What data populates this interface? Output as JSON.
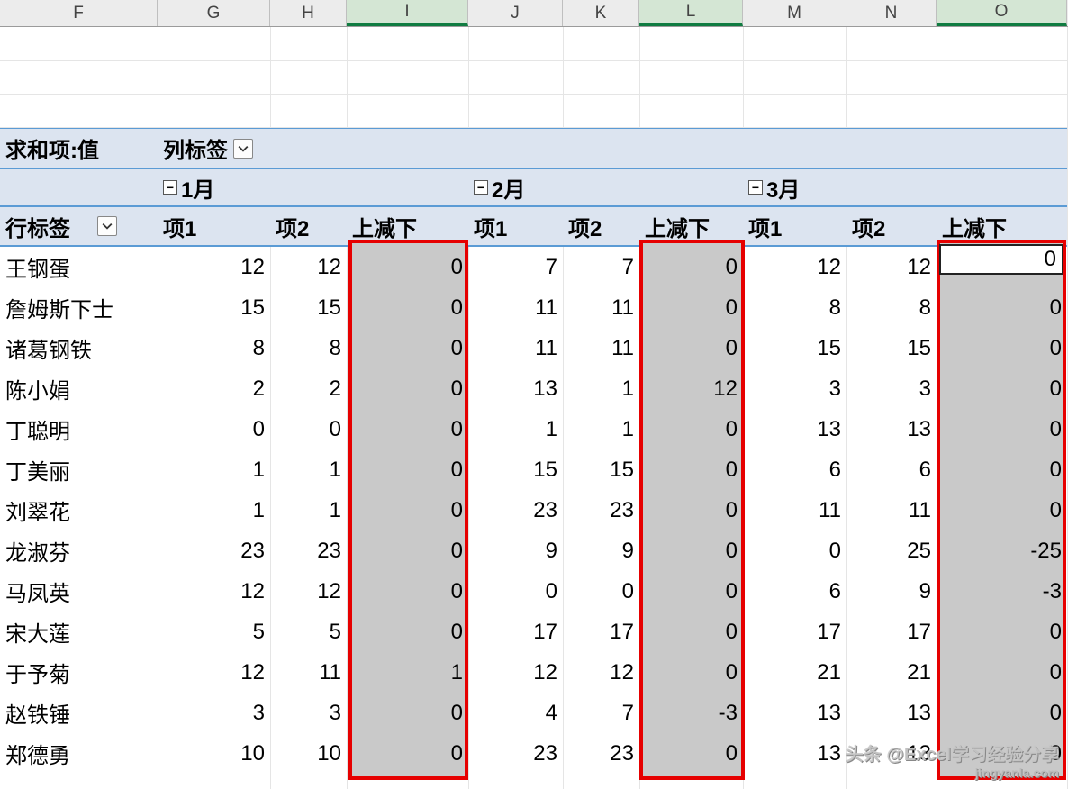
{
  "columns": [
    "F",
    "G",
    "H",
    "I",
    "J",
    "K",
    "L",
    "M",
    "N",
    "O"
  ],
  "selected_columns": [
    "I",
    "L",
    "O"
  ],
  "pivot": {
    "value_field_label": "求和项:值",
    "col_labels_label": "列标签",
    "row_labels_label": "行标签",
    "months": [
      "1月",
      "2月",
      "3月"
    ],
    "sub_labels": [
      "项1",
      "项2",
      "上减下"
    ],
    "collapse_symbol": "−"
  },
  "active_cell_value": "0",
  "rows": [
    {
      "name": "王钢蛋",
      "v": [
        12,
        12,
        0,
        7,
        7,
        0,
        12,
        12,
        0
      ]
    },
    {
      "name": "詹姆斯下士",
      "v": [
        15,
        15,
        0,
        11,
        11,
        0,
        8,
        8,
        0
      ]
    },
    {
      "name": "诸葛钢铁",
      "v": [
        8,
        8,
        0,
        11,
        11,
        0,
        15,
        15,
        0
      ]
    },
    {
      "name": "陈小娟",
      "v": [
        2,
        2,
        0,
        13,
        1,
        12,
        3,
        3,
        0
      ]
    },
    {
      "name": "丁聪明",
      "v": [
        0,
        0,
        0,
        1,
        1,
        0,
        13,
        13,
        0
      ]
    },
    {
      "name": "丁美丽",
      "v": [
        1,
        1,
        0,
        15,
        15,
        0,
        6,
        6,
        0
      ]
    },
    {
      "name": "刘翠花",
      "v": [
        1,
        1,
        0,
        23,
        23,
        0,
        11,
        11,
        0
      ]
    },
    {
      "name": "龙淑芬",
      "v": [
        23,
        23,
        0,
        9,
        9,
        0,
        0,
        25,
        -25
      ]
    },
    {
      "name": "马凤英",
      "v": [
        12,
        12,
        0,
        0,
        0,
        0,
        6,
        9,
        -3
      ]
    },
    {
      "name": "宋大莲",
      "v": [
        5,
        5,
        0,
        17,
        17,
        0,
        17,
        17,
        0
      ]
    },
    {
      "name": "于予菊",
      "v": [
        12,
        11,
        1,
        12,
        12,
        0,
        21,
        21,
        0
      ]
    },
    {
      "name": "赵铁锤",
      "v": [
        3,
        3,
        0,
        4,
        7,
        -3,
        13,
        13,
        0
      ]
    },
    {
      "name": "郑德勇",
      "v": [
        10,
        10,
        0,
        23,
        23,
        0,
        13,
        13,
        0
      ]
    }
  ],
  "watermark": {
    "line1": "头条 @Excel学习经验分享",
    "line2": "jingyanla.com"
  },
  "chart_data": {
    "type": "table",
    "title": "求和项:值",
    "row_field": "行标签",
    "column_field": "列标签",
    "column_groups": [
      "1月",
      "2月",
      "3月"
    ],
    "sub_columns": [
      "项1",
      "项2",
      "上减下"
    ],
    "rows": [
      {
        "label": "王钢蛋",
        "1月": {
          "项1": 12,
          "项2": 12,
          "上减下": 0
        },
        "2月": {
          "项1": 7,
          "项2": 7,
          "上减下": 0
        },
        "3月": {
          "项1": 12,
          "项2": 12,
          "上减下": 0
        }
      },
      {
        "label": "詹姆斯下士",
        "1月": {
          "项1": 15,
          "项2": 15,
          "上减下": 0
        },
        "2月": {
          "项1": 11,
          "项2": 11,
          "上减下": 0
        },
        "3月": {
          "项1": 8,
          "项2": 8,
          "上减下": 0
        }
      },
      {
        "label": "诸葛钢铁",
        "1月": {
          "项1": 8,
          "项2": 8,
          "上减下": 0
        },
        "2月": {
          "项1": 11,
          "项2": 11,
          "上减下": 0
        },
        "3月": {
          "项1": 15,
          "项2": 15,
          "上减下": 0
        }
      },
      {
        "label": "陈小娟",
        "1月": {
          "项1": 2,
          "项2": 2,
          "上减下": 0
        },
        "2月": {
          "项1": 13,
          "项2": 1,
          "上减下": 12
        },
        "3月": {
          "项1": 3,
          "项2": 3,
          "上减下": 0
        }
      },
      {
        "label": "丁聪明",
        "1月": {
          "项1": 0,
          "项2": 0,
          "上减下": 0
        },
        "2月": {
          "项1": 1,
          "项2": 1,
          "上减下": 0
        },
        "3月": {
          "项1": 13,
          "项2": 13,
          "上减下": 0
        }
      },
      {
        "label": "丁美丽",
        "1月": {
          "项1": 1,
          "项2": 1,
          "上减下": 0
        },
        "2月": {
          "项1": 15,
          "项2": 15,
          "上减下": 0
        },
        "3月": {
          "项1": 6,
          "项2": 6,
          "上减下": 0
        }
      },
      {
        "label": "刘翠花",
        "1月": {
          "项1": 1,
          "项2": 1,
          "上减下": 0
        },
        "2月": {
          "项1": 23,
          "项2": 23,
          "上减下": 0
        },
        "3月": {
          "项1": 11,
          "项2": 11,
          "上减下": 0
        }
      },
      {
        "label": "龙淑芬",
        "1月": {
          "项1": 23,
          "项2": 23,
          "上减下": 0
        },
        "2月": {
          "项1": 9,
          "项2": 9,
          "上减下": 0
        },
        "3月": {
          "项1": 0,
          "项2": 25,
          "上减下": -25
        }
      },
      {
        "label": "马凤英",
        "1月": {
          "项1": 12,
          "项2": 12,
          "上减下": 0
        },
        "2月": {
          "项1": 0,
          "项2": 0,
          "上减下": 0
        },
        "3月": {
          "项1": 6,
          "项2": 9,
          "上减下": -3
        }
      },
      {
        "label": "宋大莲",
        "1月": {
          "项1": 5,
          "项2": 5,
          "上减下": 0
        },
        "2月": {
          "项1": 17,
          "项2": 17,
          "上减下": 0
        },
        "3月": {
          "项1": 17,
          "项2": 17,
          "上减下": 0
        }
      },
      {
        "label": "于予菊",
        "1月": {
          "项1": 12,
          "项2": 11,
          "上减下": 1
        },
        "2月": {
          "项1": 12,
          "项2": 12,
          "上减下": 0
        },
        "3月": {
          "项1": 21,
          "项2": 21,
          "上减下": 0
        }
      },
      {
        "label": "赵铁锤",
        "1月": {
          "项1": 3,
          "项2": 3,
          "上减下": 0
        },
        "2月": {
          "项1": 4,
          "项2": 7,
          "上减下": -3
        },
        "3月": {
          "项1": 13,
          "项2": 13,
          "上减下": 0
        }
      },
      {
        "label": "郑德勇",
        "1月": {
          "项1": 10,
          "项2": 10,
          "上减下": 0
        },
        "2月": {
          "项1": 23,
          "项2": 23,
          "上减下": 0
        },
        "3月": {
          "项1": 13,
          "项2": 13,
          "上减下": 0
        }
      }
    ]
  }
}
